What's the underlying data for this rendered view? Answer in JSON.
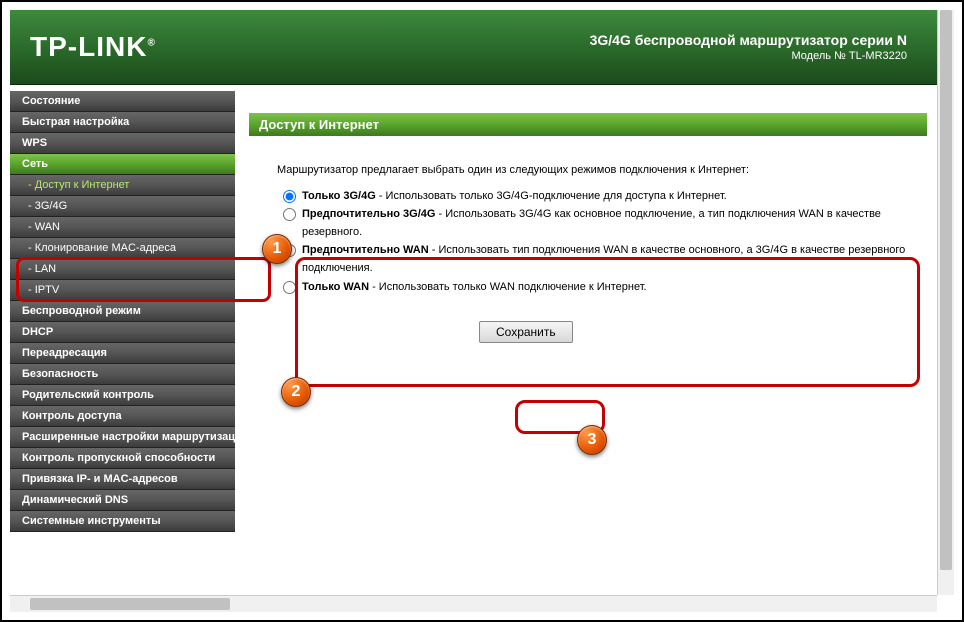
{
  "header": {
    "logo": "TP-LINK",
    "title": "3G/4G беспроводной маршрутизатор серии N",
    "model": "Модель № TL-MR3220"
  },
  "sidebar": {
    "items": [
      {
        "label": "Состояние",
        "type": "item"
      },
      {
        "label": "Быстрая настройка",
        "type": "item"
      },
      {
        "label": "WPS",
        "type": "item"
      },
      {
        "label": "Сеть",
        "type": "item",
        "active_cat": true
      },
      {
        "label": "- Доступ к Интернет",
        "type": "sub",
        "active_sub": true
      },
      {
        "label": "- 3G/4G",
        "type": "sub"
      },
      {
        "label": "- WAN",
        "type": "sub"
      },
      {
        "label": "- Клонирование MAC-адреса",
        "type": "sub"
      },
      {
        "label": "- LAN",
        "type": "sub"
      },
      {
        "label": "- IPTV",
        "type": "sub"
      },
      {
        "label": "Беспроводной режим",
        "type": "item"
      },
      {
        "label": "DHCP",
        "type": "item"
      },
      {
        "label": "Переадресация",
        "type": "item"
      },
      {
        "label": "Безопасность",
        "type": "item"
      },
      {
        "label": "Родительский контроль",
        "type": "item"
      },
      {
        "label": "Контроль доступа",
        "type": "item"
      },
      {
        "label": "Расширенные настройки маршрутизации",
        "type": "item"
      },
      {
        "label": "Контроль пропускной способности",
        "type": "item"
      },
      {
        "label": "Привязка IP- и MAC-адресов",
        "type": "item"
      },
      {
        "label": "Динамический DNS",
        "type": "item"
      },
      {
        "label": "Системные инструменты",
        "type": "item"
      }
    ]
  },
  "panel": {
    "title": "Доступ к Интернет",
    "intro": "Маршрутизатор предлагает выбрать один из следующих режимов подключения к Интернет:",
    "options": [
      {
        "name": "Только 3G/4G",
        "desc": " - Использовать только 3G/4G-подключение для доступа к Интернет.",
        "checked": true
      },
      {
        "name": "Предпочтительно 3G/4G",
        "desc": " - Использовать 3G/4G как основное подключение, а тип подключения WAN в качестве резервного.",
        "checked": false
      },
      {
        "name": "Предпочтительно WAN",
        "desc": " - Использовать тип подключения WAN в качестве основного, а 3G/4G в качестве резервного подключения.",
        "checked": false
      },
      {
        "name": "Только WAN",
        "desc": " - Использовать только WAN подключение к Интернет.",
        "checked": false
      }
    ],
    "save": "Сохранить"
  },
  "annotations": {
    "b1": "1",
    "b2": "2",
    "b3": "3"
  }
}
